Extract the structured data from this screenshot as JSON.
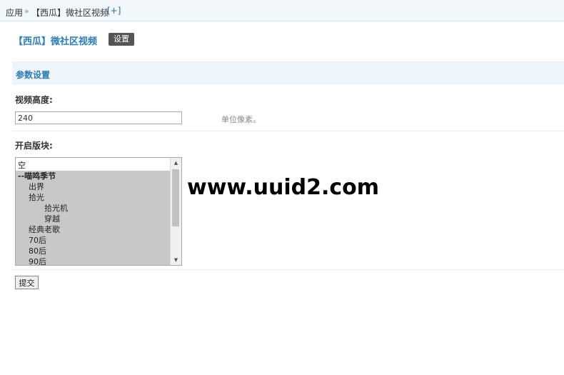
{
  "breadcrumb": {
    "root": "应用",
    "separator": "»",
    "current": "【西瓜】微社区视频",
    "add": "[+]"
  },
  "plugin": {
    "title": "【西瓜】微社区视频",
    "settings_button": "设置"
  },
  "section": {
    "title": "参数设置"
  },
  "video_height": {
    "label": "视频高度:",
    "value": "240",
    "hint": "单位像素。"
  },
  "boards": {
    "label": "开启版块:",
    "options": [
      {
        "label": "空",
        "indent": 0,
        "selected": false,
        "bold": false
      },
      {
        "label": "--喵鸣季节",
        "indent": 0,
        "selected": true,
        "bold": true
      },
      {
        "label": "出界",
        "indent": 1,
        "selected": true,
        "bold": false
      },
      {
        "label": "拾光",
        "indent": 1,
        "selected": true,
        "bold": false
      },
      {
        "label": "拾光机",
        "indent": 2,
        "selected": true,
        "bold": false
      },
      {
        "label": "穿越",
        "indent": 2,
        "selected": true,
        "bold": false
      },
      {
        "label": "经典老歌",
        "indent": 1,
        "selected": true,
        "bold": false
      },
      {
        "label": "70后",
        "indent": 1,
        "selected": true,
        "bold": false
      },
      {
        "label": "80后",
        "indent": 1,
        "selected": true,
        "bold": false
      },
      {
        "label": "90后",
        "indent": 1,
        "selected": true,
        "bold": false
      }
    ]
  },
  "submit": {
    "label": "提交"
  },
  "watermark": "www.uuid2.com"
}
